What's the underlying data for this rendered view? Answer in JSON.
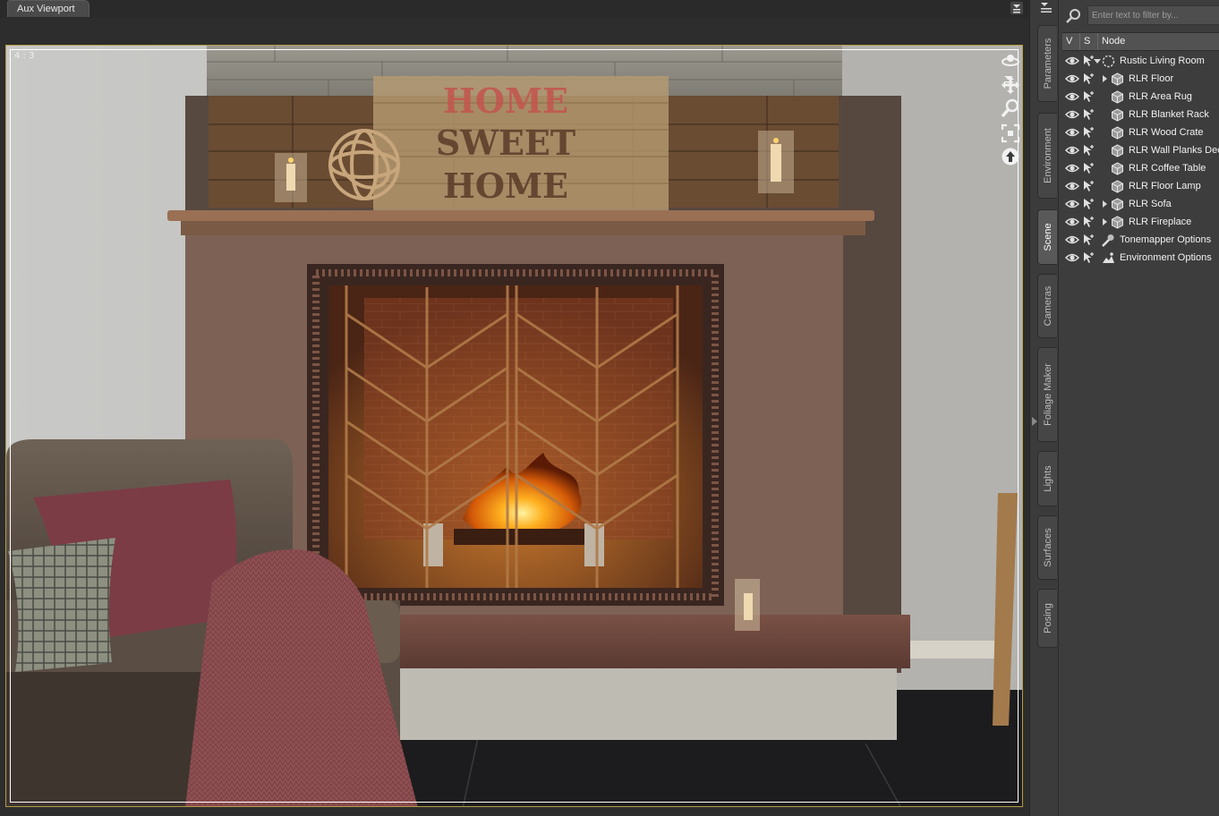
{
  "viewport": {
    "tab_label": "Aux Viewport",
    "aspect_label": "4 : 3",
    "mantel_sign": {
      "line1": "HOME",
      "line2": "SWEET",
      "line3": "HOME"
    },
    "tools": [
      "orbit-icon",
      "pan-icon",
      "zoom-icon",
      "frame-icon",
      "reset-view-icon"
    ]
  },
  "side_tabs": [
    "Parameters",
    "Environment",
    "Scene",
    "Cameras",
    "Foliage Maker",
    "Lights",
    "Surfaces",
    "Posing"
  ],
  "side_tabs_active": "Scene",
  "scene_panel": {
    "filter_placeholder": "Enter text to filter by...",
    "columns": {
      "visible": "V",
      "selectable": "S",
      "node": "Node"
    },
    "nodes": [
      {
        "label": "Rustic Living Room",
        "icon": "group-icon",
        "expander": "down",
        "depth": 0
      },
      {
        "label": "RLR Floor",
        "icon": "prop-icon",
        "expander": "right",
        "depth": 1
      },
      {
        "label": "RLR Area Rug",
        "icon": "prop-icon",
        "expander": "",
        "depth": 1
      },
      {
        "label": "RLR Blanket Rack",
        "icon": "prop-icon",
        "expander": "",
        "depth": 1
      },
      {
        "label": "RLR Wood Crate",
        "icon": "prop-icon",
        "expander": "",
        "depth": 1
      },
      {
        "label": "RLR Wall Planks Decor",
        "icon": "prop-icon",
        "expander": "",
        "depth": 1
      },
      {
        "label": "RLR Coffee Table",
        "icon": "prop-icon",
        "expander": "",
        "depth": 1
      },
      {
        "label": "RLR Floor Lamp",
        "icon": "prop-icon",
        "expander": "",
        "depth": 1
      },
      {
        "label": "RLR Sofa",
        "icon": "prop-icon",
        "expander": "right",
        "depth": 1
      },
      {
        "label": "RLR Fireplace",
        "icon": "prop-icon",
        "expander": "right",
        "depth": 1
      },
      {
        "label": "Tonemapper Options",
        "icon": "tonemapper-icon",
        "expander": "",
        "depth": 0
      },
      {
        "label": "Environment Options",
        "icon": "environment-icon",
        "expander": "",
        "depth": 0
      }
    ]
  },
  "colors": {
    "frame_border": "#b59c44",
    "panel_bg": "#3d3d3d",
    "fire": "#ff9a1a"
  }
}
